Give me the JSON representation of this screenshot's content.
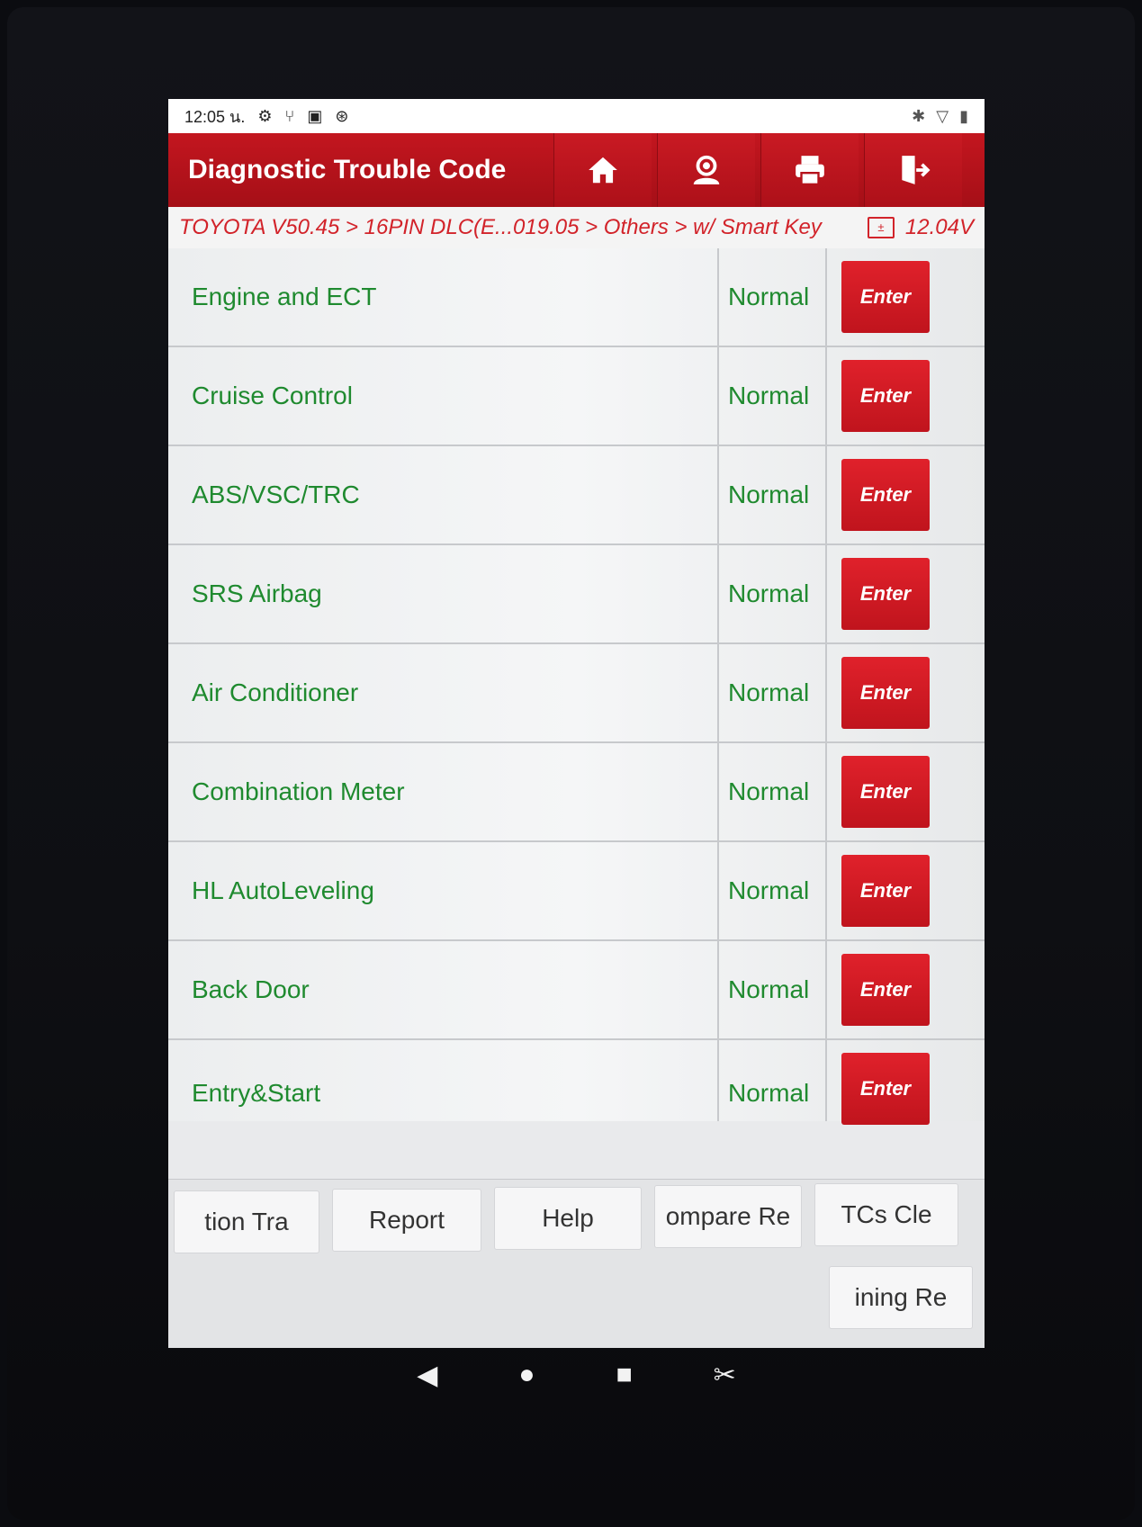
{
  "status_bar": {
    "time": "12:05 น.",
    "left_icons": [
      "gear-icon",
      "usb-icon",
      "image-icon",
      "accessibility-icon"
    ],
    "right_icons": [
      "bluetooth-icon",
      "wifi-icon",
      "battery-icon"
    ]
  },
  "header": {
    "title": "Diagnostic Trouble Code",
    "buttons": [
      "home-icon",
      "user-support-icon",
      "print-icon",
      "exit-icon"
    ],
    "accent_color": "#b5121b"
  },
  "breadcrumb": {
    "path": "TOYOTA V50.45 > 16PIN DLC(E...019.05 > Others > w/ Smart Key",
    "voltage": "12.04V"
  },
  "systems": [
    {
      "name": "Engine and ECT",
      "status": "Normal",
      "action": "Enter"
    },
    {
      "name": "Cruise Control",
      "status": "Normal",
      "action": "Enter"
    },
    {
      "name": "ABS/VSC/TRC",
      "status": "Normal",
      "action": "Enter"
    },
    {
      "name": "SRS Airbag",
      "status": "Normal",
      "action": "Enter"
    },
    {
      "name": "Air Conditioner",
      "status": "Normal",
      "action": "Enter"
    },
    {
      "name": "Combination Meter",
      "status": "Normal",
      "action": "Enter"
    },
    {
      "name": "HL AutoLeveling",
      "status": "Normal",
      "action": "Enter"
    },
    {
      "name": "Back Door",
      "status": "Normal",
      "action": "Enter"
    },
    {
      "name": "Entry&Start",
      "status": "Normal",
      "action": "Enter"
    }
  ],
  "function_bar": {
    "row1": [
      "tion    Tra",
      "Report",
      "Help",
      "ompare Re",
      "TCs    Cle"
    ],
    "row2": [
      "ining    Re"
    ]
  },
  "nav_bar": [
    "back-icon",
    "home-circle-icon",
    "recents-square-icon",
    "screenshot-icon"
  ]
}
